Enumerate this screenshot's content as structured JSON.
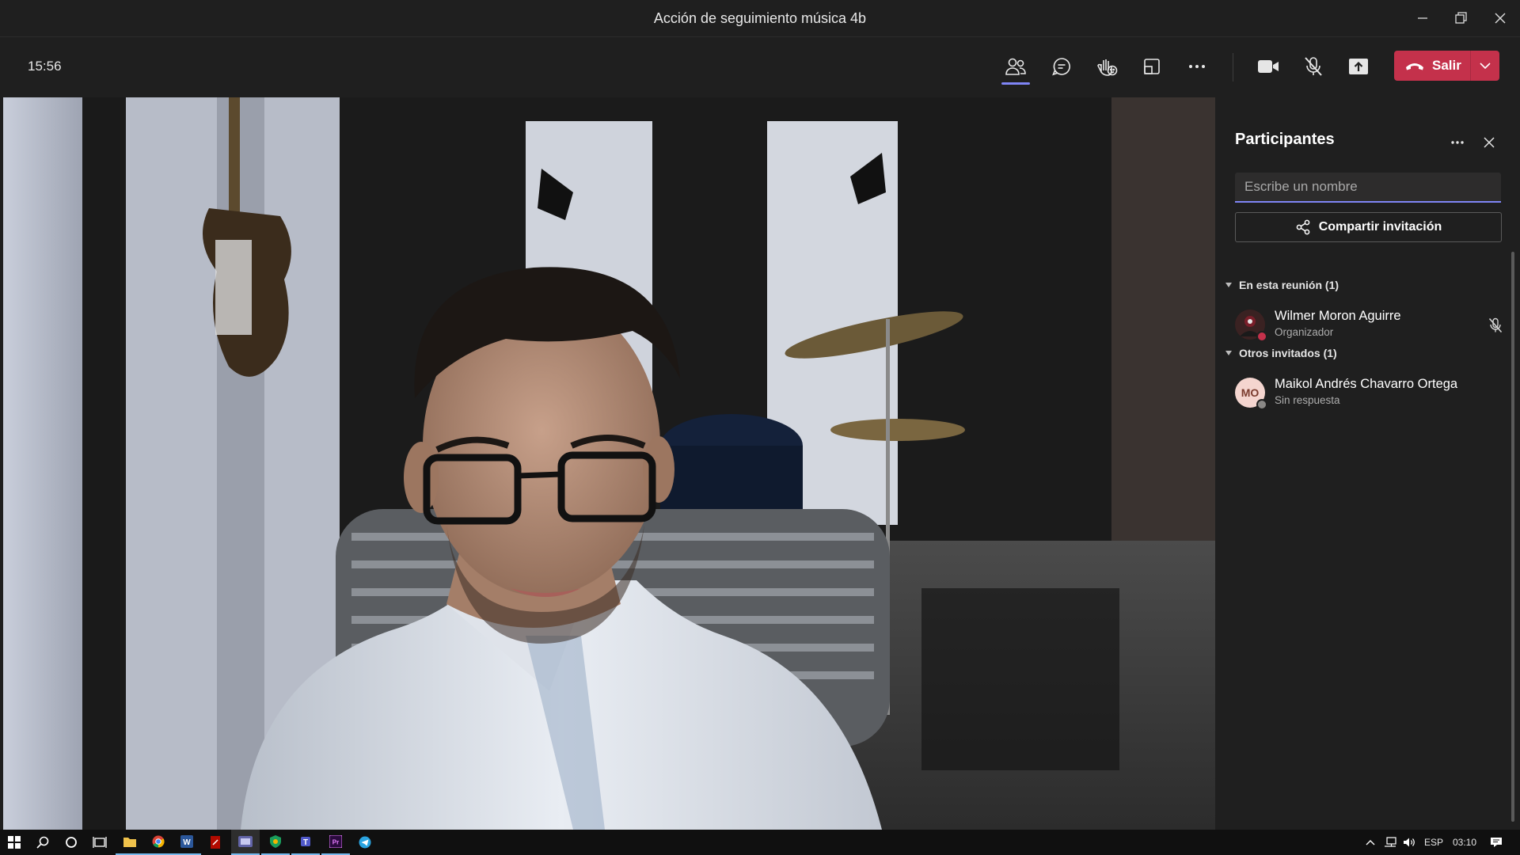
{
  "window": {
    "title": "Acción de seguimiento música 4b"
  },
  "toolbar": {
    "elapsed_time": "15:56",
    "leave_label": "Salir"
  },
  "panel": {
    "title": "Participantes",
    "search_placeholder": "Escribe un nombre",
    "share_label": "Compartir invitación",
    "sections": [
      {
        "header": "En esta reunión (1)",
        "people": [
          {
            "name": "Wilmer Moron Aguirre",
            "role": "Organizador",
            "initials": "",
            "status_color": "#c4314b",
            "muted": true
          }
        ]
      },
      {
        "header": "Otros invitados (1)",
        "people": [
          {
            "name": "Maikol Andrés Chavarro Ortega",
            "role": "Sin respuesta",
            "initials": "MO",
            "status_color": "#8a8886",
            "muted": false
          }
        ]
      }
    ]
  },
  "taskbar": {
    "language": "ESP",
    "time": "03:10"
  },
  "colors": {
    "accent": "#7f85f5",
    "leave": "#c4314b",
    "background": "#1f1f1f"
  }
}
